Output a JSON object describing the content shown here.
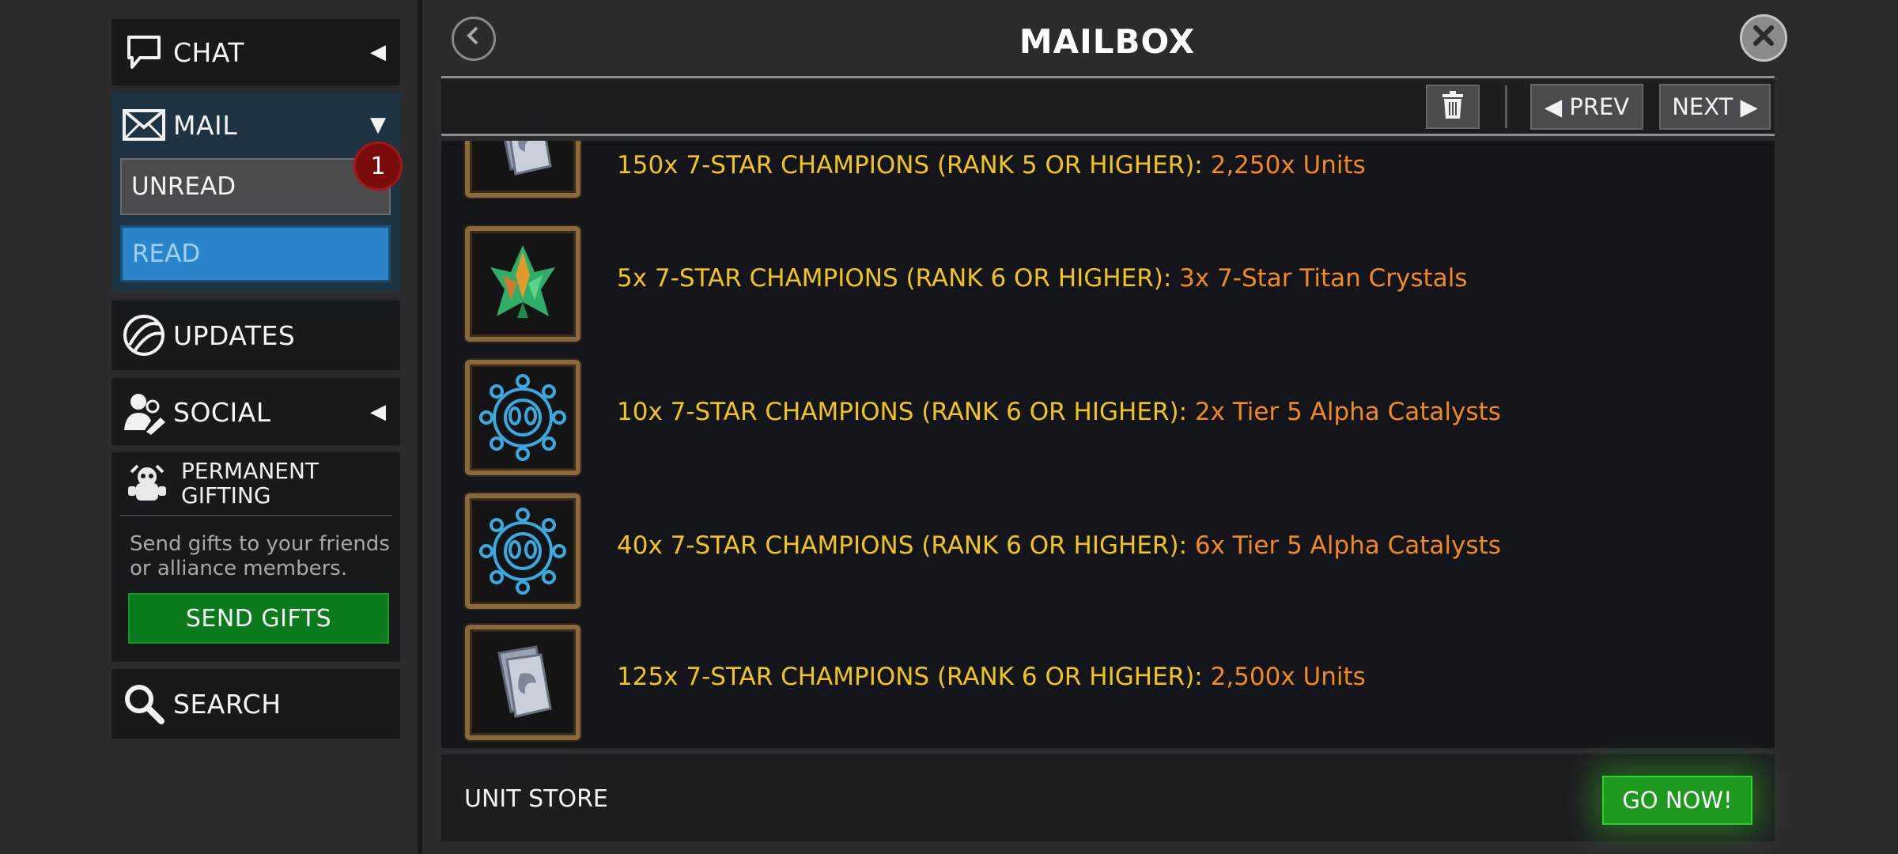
{
  "sidebar": {
    "chat": {
      "label": "CHAT",
      "icon": "chat-bubble-icon",
      "arrow": "◀"
    },
    "mail": {
      "label": "MAIL",
      "icon": "envelope-icon",
      "arrow": "▼"
    },
    "unread": {
      "label": "UNREAD",
      "badge": "1"
    },
    "read": {
      "label": "READ"
    },
    "updates": {
      "label": "UPDATES",
      "icon": "globe-icon"
    },
    "social": {
      "label": "SOCIAL",
      "icon": "people-icon",
      "arrow": "◀"
    },
    "gifting": {
      "title": "PERMANENT GIFTING",
      "icon": "gift-creature-icon",
      "description": "Send gifts to your friends or alliance members.",
      "button": "SEND GIFTS"
    },
    "search": {
      "label": "SEARCH",
      "icon": "search-icon"
    }
  },
  "header": {
    "title": "MAILBOX",
    "back_icon": "chevron-left-icon",
    "close_icon": "close-icon"
  },
  "toolbar": {
    "delete_icon": "trash-icon",
    "prev": "◀ PREV",
    "next": "NEXT ▶"
  },
  "rewards": [
    {
      "requirement": "150x 7-STAR CHAMPIONS (RANK 5 OR HIGHER): ",
      "reward": "2,250x Units",
      "icon": "units-card-icon"
    },
    {
      "requirement": "5x 7-STAR CHAMPIONS (RANK 6 OR HIGHER): ",
      "reward": "3x 7-Star Titan Crystals",
      "icon": "titan-crystal-icon"
    },
    {
      "requirement": "10x 7-STAR CHAMPIONS (RANK 6 OR HIGHER): ",
      "reward": "2x Tier 5 Alpha Catalysts",
      "icon": "alpha-catalyst-icon"
    },
    {
      "requirement": "40x 7-STAR CHAMPIONS (RANK 6 OR HIGHER): ",
      "reward": "6x Tier 5 Alpha Catalysts",
      "icon": "alpha-catalyst-icon"
    },
    {
      "requirement": "125x 7-STAR CHAMPIONS (RANK 6 OR HIGHER): ",
      "reward": "2,500x Units",
      "icon": "units-card-icon"
    }
  ],
  "footer": {
    "store_label": "UNIT STORE",
    "button": "GO NOW!"
  },
  "colors": {
    "requirement_text": "#f0c419",
    "reward_text": "#f18a1e",
    "read_selected": "#2a84c9",
    "send_gifts": "#0b7a1c",
    "go_now": "#1d9a1d",
    "badge": "#7a0b0b"
  }
}
